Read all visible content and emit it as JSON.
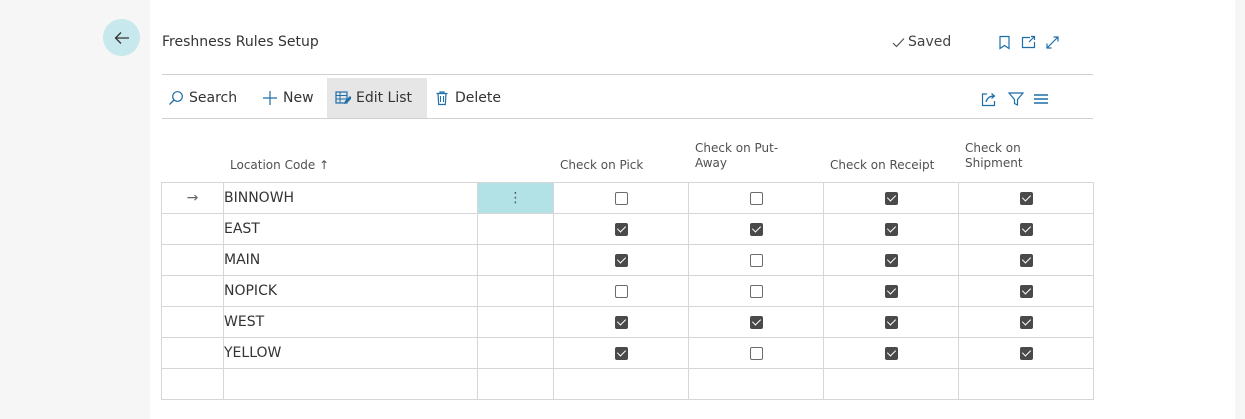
{
  "header": {
    "title": "Freshness Rules Setup",
    "saved_label": "Saved"
  },
  "toolbar": {
    "search_label": "Search",
    "new_label": "New",
    "edit_list_label": "Edit List",
    "delete_label": "Delete"
  },
  "table": {
    "columns": {
      "location_code": "Location Code ↑",
      "check_on_pick": "Check on Pick",
      "check_on_putaway_1": "Check on Put-",
      "check_on_putaway_2": "Away",
      "check_on_receipt": "Check on Receipt",
      "check_on_shipment_1": "Check on",
      "check_on_shipment_2": "Shipment"
    },
    "selected_row_arrow": "→",
    "row_menu_glyph": "⋮",
    "rows": [
      {
        "code": "BINNOWH",
        "pick": false,
        "putaway": false,
        "receipt": true,
        "shipment": true
      },
      {
        "code": "EAST",
        "pick": true,
        "putaway": true,
        "receipt": true,
        "shipment": true
      },
      {
        "code": "MAIN",
        "pick": true,
        "putaway": false,
        "receipt": true,
        "shipment": true
      },
      {
        "code": "NOPICK",
        "pick": false,
        "putaway": false,
        "receipt": true,
        "shipment": true
      },
      {
        "code": "WEST",
        "pick": true,
        "putaway": true,
        "receipt": true,
        "shipment": true
      },
      {
        "code": "YELLOW",
        "pick": true,
        "putaway": false,
        "receipt": true,
        "shipment": true
      }
    ]
  },
  "icons": {
    "back": "arrow-left-icon",
    "saved": "checkmark-icon",
    "bookmark": "bookmark-icon",
    "open_new_window": "open-in-new-window-icon",
    "expand": "expand-icon",
    "search": "search-icon",
    "new": "plus-icon",
    "edit_list": "edit-list-icon",
    "delete": "trash-icon",
    "share": "share-icon",
    "filter": "filter-icon",
    "list_view": "list-view-icon"
  },
  "colors": {
    "accent": "#b2e1e6",
    "back_button": "#c7e8ec",
    "icon_blue": "#1f6ea8"
  }
}
